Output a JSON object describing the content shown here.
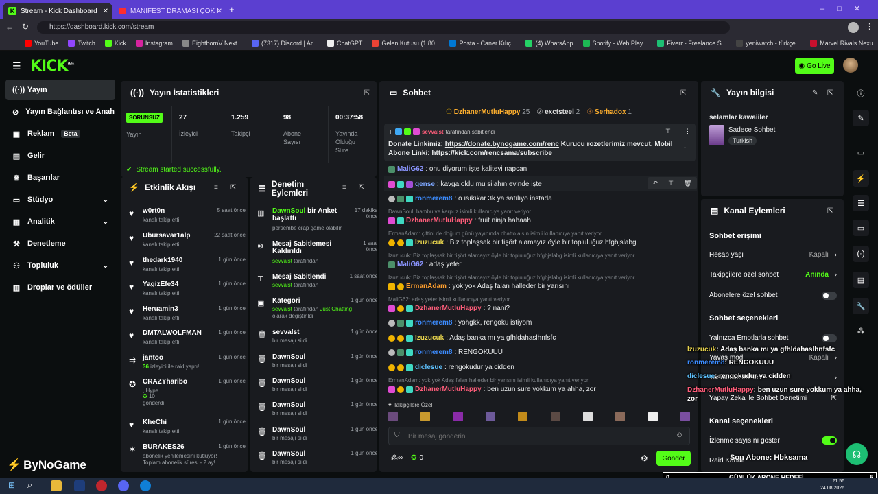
{
  "browser": {
    "tabs": [
      {
        "title": "Stream - Kick Dashboard"
      },
      {
        "title": "MANİFEST DRAMASI ÇOK FENA!"
      }
    ],
    "url": "https://dashboard.kick.com/stream",
    "bookmarks": [
      "YouTube",
      "Twitch",
      "Kick",
      "Instagram",
      "EightbornV Next...",
      "(7317) Discord | Ar...",
      "ChatGPT",
      "Gelen Kutusu (1.80...",
      "Posta - Caner Kılıç...",
      "(4) WhatsApp",
      "Spotify - Web Play...",
      "Fiverr - Freelance S...",
      "yeniwatch - türkçe...",
      "Marvel Rivals Nexu..."
    ]
  },
  "header": {
    "logo": "KICK",
    "logo_sup": "BETA",
    "go_live": "Go Live"
  },
  "sidebar": {
    "items": [
      {
        "label": "Yayın",
        "icon": "broadcast-icon"
      },
      {
        "label": "Yayın Bağlantısı ve Anahtarı",
        "icon": "link-icon"
      },
      {
        "label": "Reklam",
        "icon": "ad-icon",
        "badge": "Beta"
      },
      {
        "label": "Gelir",
        "icon": "revenue-icon"
      },
      {
        "label": "Başarılar",
        "icon": "trophy-icon"
      },
      {
        "label": "Stüdyo",
        "icon": "studio-icon"
      },
      {
        "label": "Analitik",
        "icon": "chart-icon"
      },
      {
        "label": "Denetleme",
        "icon": "hammer-icon"
      },
      {
        "label": "Topluluk",
        "icon": "community-icon"
      },
      {
        "label": "Droplar ve ödüller",
        "icon": "gift-icon"
      }
    ]
  },
  "stats": {
    "title": "Yayın İstatistikleri",
    "status_badge": "SORUNSUZ",
    "status_label": "Yayın",
    "items": [
      {
        "value": "27",
        "label": "İzleyici"
      },
      {
        "value": "1.259",
        "label": "Takipçi"
      },
      {
        "value": "98",
        "label": "Abone Sayısı"
      },
      {
        "value": "00:37:58",
        "label": "Yayında Olduğu Süre"
      }
    ],
    "success": "Stream started successfully."
  },
  "activity": {
    "title": "Etkinlik Akışı",
    "items": [
      {
        "name": "w0rt0n",
        "sub": "kanalı takip etti",
        "time": "5 saat önce"
      },
      {
        "name": "Ubursavar1alp",
        "sub": "kanalı takip etti",
        "time": "22 saat önce"
      },
      {
        "name": "thedark1940",
        "sub": "kanalı takip etti",
        "time": "1 gün önce"
      },
      {
        "name": "YagizEfe34",
        "sub": "kanalı takip etti",
        "time": "1 gün önce"
      },
      {
        "name": "Heruamin3",
        "sub": "kanalı takip etti",
        "time": "1 gün önce"
      },
      {
        "name": "DMTALWOLFMAN",
        "sub": "kanalı takip etti",
        "time": "1 gün önce"
      },
      {
        "name": "jantoo",
        "sub_green": "36",
        "sub": "izleyici ile raid yaptı!",
        "time": "1 gün önce"
      },
      {
        "name": "CRAZYharibo",
        "sub_green": ", Hype",
        "sub": "10",
        "sub2": "gönderdi",
        "time": "1 gün önce"
      },
      {
        "name": "KheChi",
        "sub": "kanalı takip etti",
        "time": "1 gün önce"
      },
      {
        "name": "BURAKES26",
        "sub": "abonelik yenilemesini kutluyor!",
        "sub2": "Toplam abonelik süresi - 2 ay!",
        "time": "1 gün önce"
      }
    ]
  },
  "moderation": {
    "title": "Denetim Eylemleri",
    "items": [
      {
        "name_green": "DawnSoul",
        "name": "bir Anket başlattı",
        "sub": "persembe crap game olabilir",
        "time": "17 dakika önce"
      },
      {
        "name": "Mesaj Sabitlemesi Kaldırıldı",
        "sub_green": "sevvalst",
        "sub": "tarafından",
        "time": "1 saat önce"
      },
      {
        "name": "Mesaj Sabitlendi",
        "sub_green": "sevvalst",
        "sub": "tarafından",
        "time": "1 saat önce"
      },
      {
        "name": "Kategori",
        "sub_green": "sevvalst",
        "sub": "tarafından",
        "sub_green2": "Just Chatting",
        "sub2": "olarak değiştirildi",
        "time": "1 gün önce"
      },
      {
        "name": "sevvalst",
        "sub": "bir mesajı sildi",
        "time": "1 gün önce"
      },
      {
        "name": "DawnSoul",
        "sub": "bir mesajı sildi",
        "time": "1 gün önce"
      },
      {
        "name": "DawnSoul",
        "sub": "bir mesajı sildi",
        "time": "1 gün önce"
      },
      {
        "name": "DawnSoul",
        "sub": "bir mesajı sildi",
        "time": "1 gün önce"
      },
      {
        "name": "DawnSoul",
        "sub": "bir mesajı sildi",
        "time": "1 gün önce"
      },
      {
        "name": "DawnSoul",
        "sub": "bir mesajı sildi",
        "time": "1 gün önce"
      }
    ]
  },
  "chat": {
    "title": "Sohbet",
    "leaders": [
      {
        "name": "DzhanerMutluHappy",
        "count": "25"
      },
      {
        "name": "exctsteel",
        "count": "2"
      },
      {
        "name": "Serhadox",
        "count": "1"
      }
    ],
    "pinned": {
      "by": "sevvalst",
      "by_suffix": "tarafından sabitlendi",
      "line1_a": "Donate Linkimiz: ",
      "line1_link": "https://donate.bynogame.com/renc",
      "line1_b": " Kurucu rozetlerimiz mevcut. Mobil",
      "line2_a": "Abone Linki: ",
      "line2_link": "https://kick.com/rencsama/subscribe"
    },
    "messages": [
      {
        "reply": "",
        "user": "MaliG62",
        "color": "#8b95ff",
        "text": ": onu diyorum işte kaliteyi napcan"
      },
      {
        "reply": "",
        "user": "qense",
        "color": "#7da7ff",
        "text": ": kavga oldu mu silahın evinde işte"
      },
      {
        "reply": "",
        "user": "ronmerem8",
        "color": "#3c8cff",
        "text": ": o ısıkıkar 3k ya satılıyo instada"
      },
      {
        "reply": "DawnSoul: bambu ve karpuz isimli kullanıcıya yanıt veriyor",
        "user": "DzhanerMutluHappy",
        "color": "#ff5d7a",
        "text": ": fruit ninja hahaah"
      },
      {
        "reply": "ErmanAdam: çiftini de doğum günü yayınında chatto alsın isimli kullanıcıya yanıt veriyor",
        "user": "Izuzucuk",
        "color": "#e8d44d",
        "text": ": Biz toplaşsak bir tişört alamayız öyle bir topluluğuz hfgbjslabg"
      },
      {
        "reply": "Izuzucuk: Biz toplaşsak bir tişört alamayız öyle bir topluluğuz hfgbjslabg isimli kullanıcıya yanıt veriyor",
        "user": "MaliG62",
        "color": "#8b95ff",
        "text": ": adaş yeter"
      },
      {
        "reply": "Izuzucuk: Biz toplaşsak bir tişört alamayız öyle bir topluluğuz hfgbjslabg isimli kullanıcıya yanıt veriyor",
        "user": "ErmanAdam",
        "color": "#ff9f2e",
        "text": ": yok yok Adaş falan halleder bir yarısını"
      },
      {
        "reply": "MaliG62: adaş yeter isimli kullanıcıya yanıt veriyor",
        "user": "DzhanerMutluHappy",
        "color": "#ff5d7a",
        "text": ": ? nani?"
      },
      {
        "reply": "",
        "user": "ronmerem8",
        "color": "#3c8cff",
        "text": ": yohgkk, rengoku istiyom"
      },
      {
        "reply": "",
        "user": "Izuzucuk",
        "color": "#e8d44d",
        "text": ": Adaş banka mı ya gfhldahaslhnfsfc"
      },
      {
        "reply": "",
        "user": "ronmerem8",
        "color": "#3c8cff",
        "text": ": RENGOKUUU"
      },
      {
        "reply": "",
        "user": "diclesue",
        "color": "#5ec2ff",
        "text": ": rengokudur ya cidden"
      },
      {
        "reply": "ErmanAdam: yok yok Adaş falan halleder bir yarısını isimli kullanıcıya yanıt veriyor",
        "user": "DzhanerMutluHappy",
        "color": "#ff5d7a",
        "text": ": ben uzun sure yokkum ya ahha, zor"
      }
    ],
    "followers_only": "Takipçilere Özel",
    "input_placeholder": "Bir mesaj gönderin",
    "points": "0",
    "send": "Gönder"
  },
  "info": {
    "title": "Yayın bilgisi",
    "stream_title": "selamlar kawaiiler",
    "category": "Sadece Sohbet",
    "tag": "Turkish"
  },
  "channel_actions": {
    "title": "Kanal Eylemleri",
    "section1": "Sohbet erişimi",
    "rows1": [
      {
        "label": "Hesap yaşı",
        "value": "Kapalı"
      },
      {
        "label": "Takipçilere özel sohbet",
        "value": "Anında"
      },
      {
        "label": "Abonelere özel sohbet",
        "value": ""
      }
    ],
    "section2": "Sohbet seçenekleri",
    "rows2": [
      {
        "label": "Yalnızca Emotlarla sohbet",
        "value": ""
      },
      {
        "label": "Yavaş mod",
        "value": "Kapalı"
      },
      {
        "label": "Yasaklı kelimeler",
        "value": ""
      },
      {
        "label": "Yapay Zeka ile Sohbet Denetimi",
        "value": ""
      }
    ],
    "section3": "Kanal seçenekleri",
    "rows3": [
      {
        "label": "İzlenme sayısını göster",
        "value": ""
      },
      {
        "label": "Raid Kanalı",
        "value": ""
      }
    ]
  },
  "overlay": {
    "chat": [
      {
        "user": "Izuzucuk",
        "color": "#e8d44d",
        "text": ": Adaş banka mı ya gfhldahaslhnfsfc"
      },
      {
        "user": "ronmerem8",
        "color": "#3c8cff",
        "text": ": RENGOKUUU"
      },
      {
        "user": "diclesue",
        "color": "#5ec2ff",
        "text": ": rengokudur ya cidden"
      },
      {
        "user": "DzhanerMutluHappy",
        "color": "#ff5d7a",
        "text": ": ben uzun sure yokkum ya ahha, zor"
      }
    ],
    "last_sub": "Son Abone: Hbksama",
    "goal_label": "GÜNLÜK ABONE HEDEFİ",
    "goal_min": "0",
    "goal_max": "5",
    "brand": "ByNoGame"
  },
  "taskbar": {
    "time": "21:56",
    "date": "24.08.2026"
  },
  "colors": {
    "accent": "#53fc18",
    "tabbar": "#5b3fd0",
    "panel": "#191b1f"
  }
}
